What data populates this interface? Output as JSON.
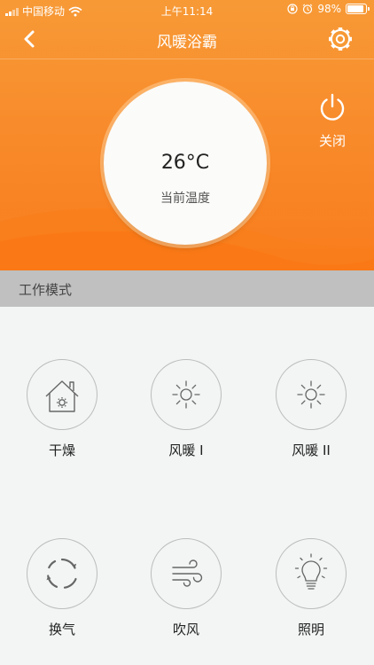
{
  "status_bar": {
    "carrier": "中国移动",
    "time": "上午11:14",
    "battery_percent": "98%",
    "battery_level": 0.98
  },
  "header": {
    "back_icon": "chevron-left-icon",
    "title": "风暖浴霸",
    "settings_icon": "gear-icon"
  },
  "temperature": {
    "value": "26°C",
    "label": "当前温度"
  },
  "power": {
    "icon": "power-icon",
    "label": "关闭"
  },
  "modes": {
    "section_title": "工作模式",
    "items": [
      {
        "label": "干燥",
        "icon": "house-sun-icon"
      },
      {
        "label": "风暖 I",
        "icon": "sun-icon"
      },
      {
        "label": "风暖 II",
        "icon": "sun-icon"
      },
      {
        "label": "换气",
        "icon": "circular-arrows-icon"
      },
      {
        "label": "吹风",
        "icon": "wind-icon"
      },
      {
        "label": "照明",
        "icon": "lightbulb-icon"
      }
    ]
  },
  "colors": {
    "hero_orange": "#f88c2c",
    "section_header_bg": "#c0c0c0",
    "page_bg": "#f2f5f4",
    "icon_stroke": "#666666"
  }
}
